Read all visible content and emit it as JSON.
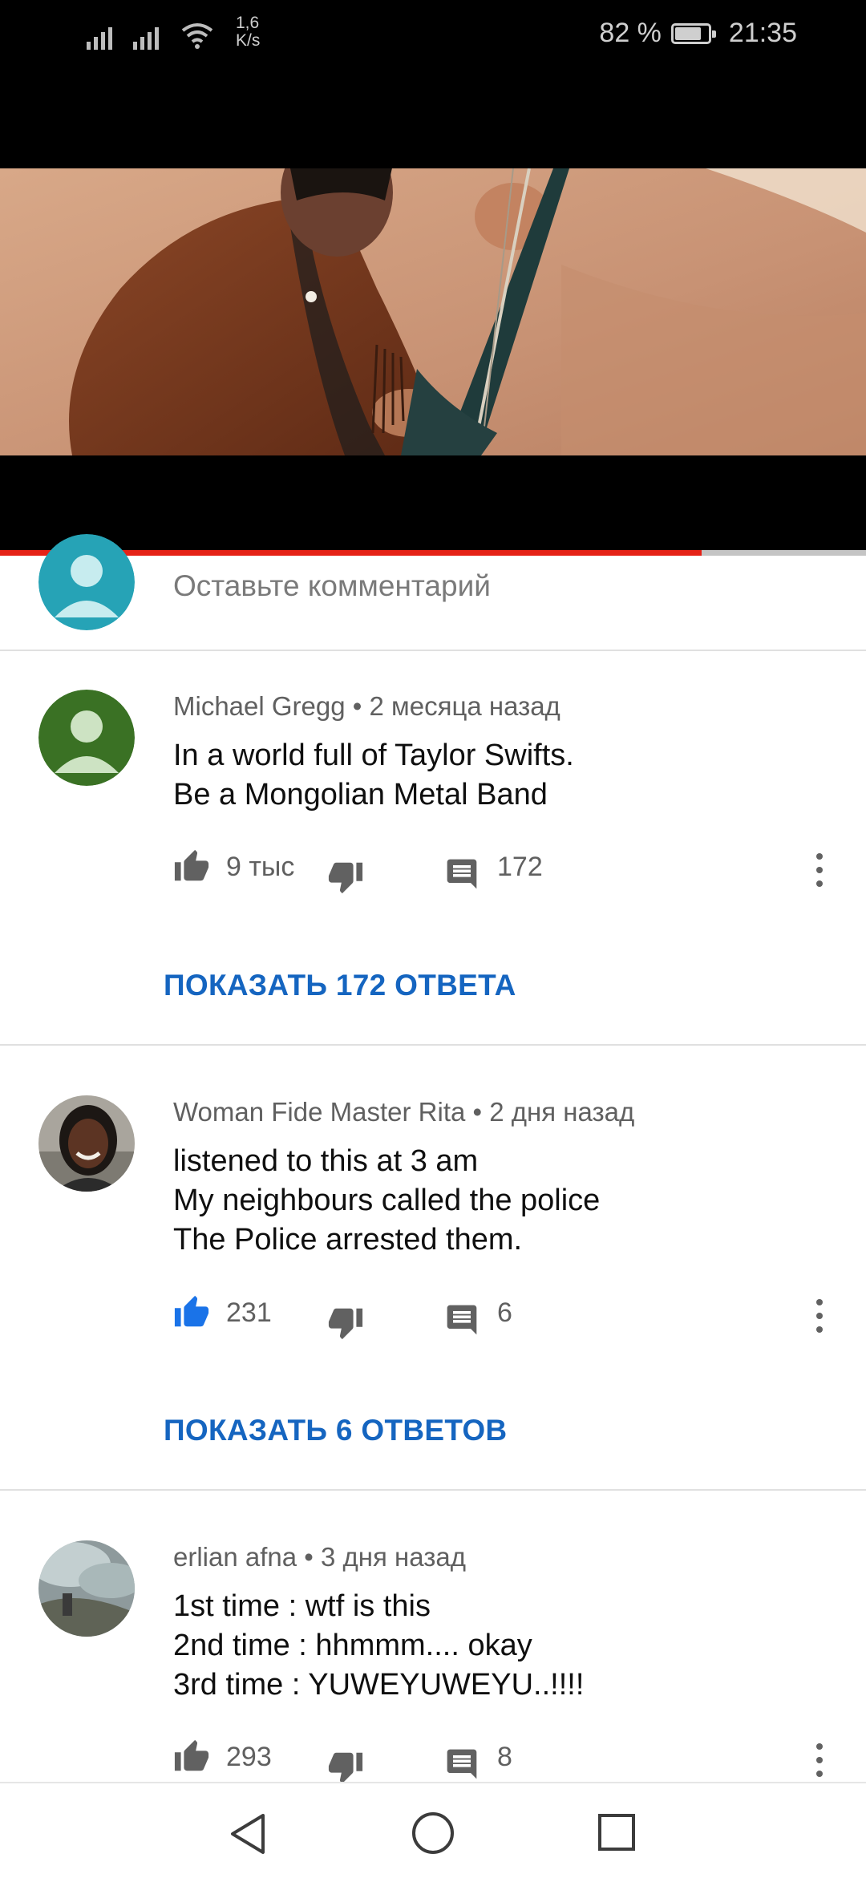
{
  "status_bar": {
    "net_speed_value": "1,6",
    "net_speed_unit": "K/s",
    "battery_text": "82 %",
    "battery_level": 0.82,
    "time": "21:35"
  },
  "video": {
    "progress": 0.81,
    "progress_color": "#e52217"
  },
  "comment_input": {
    "placeholder": "Оставьте комментарий"
  },
  "comments": [
    {
      "author": "Michael Gregg",
      "age": "2 месяца назад",
      "text": "In a world full of Taylor Swifts.\nBe a Mongolian Metal Band",
      "likes": "9 тыс",
      "liked": false,
      "replies": "172",
      "show_replies": "ПОКАЗАТЬ 172 ОТВЕТА"
    },
    {
      "author": "Woman Fide Master Rita",
      "age": "2 дня назад",
      "text": "listened to this at 3 am\nMy neighbours called the police\nThe Police arrested them.",
      "likes": "231",
      "liked": true,
      "replies": "6",
      "show_replies": "ПОКАЗАТЬ 6 ОТВЕТОВ"
    },
    {
      "author": "erlian afna",
      "age": "3 дня назад",
      "text": "1st time : wtf is this\n2nd time : hhmmm.... okay\n3rd time : YUWEYUWEYU..!!!!",
      "likes": "293",
      "liked": false,
      "replies": "8"
    }
  ],
  "colors": {
    "accent_blue": "#1565c0",
    "like_active": "#1a73e8",
    "meta_gray": "#606060"
  }
}
